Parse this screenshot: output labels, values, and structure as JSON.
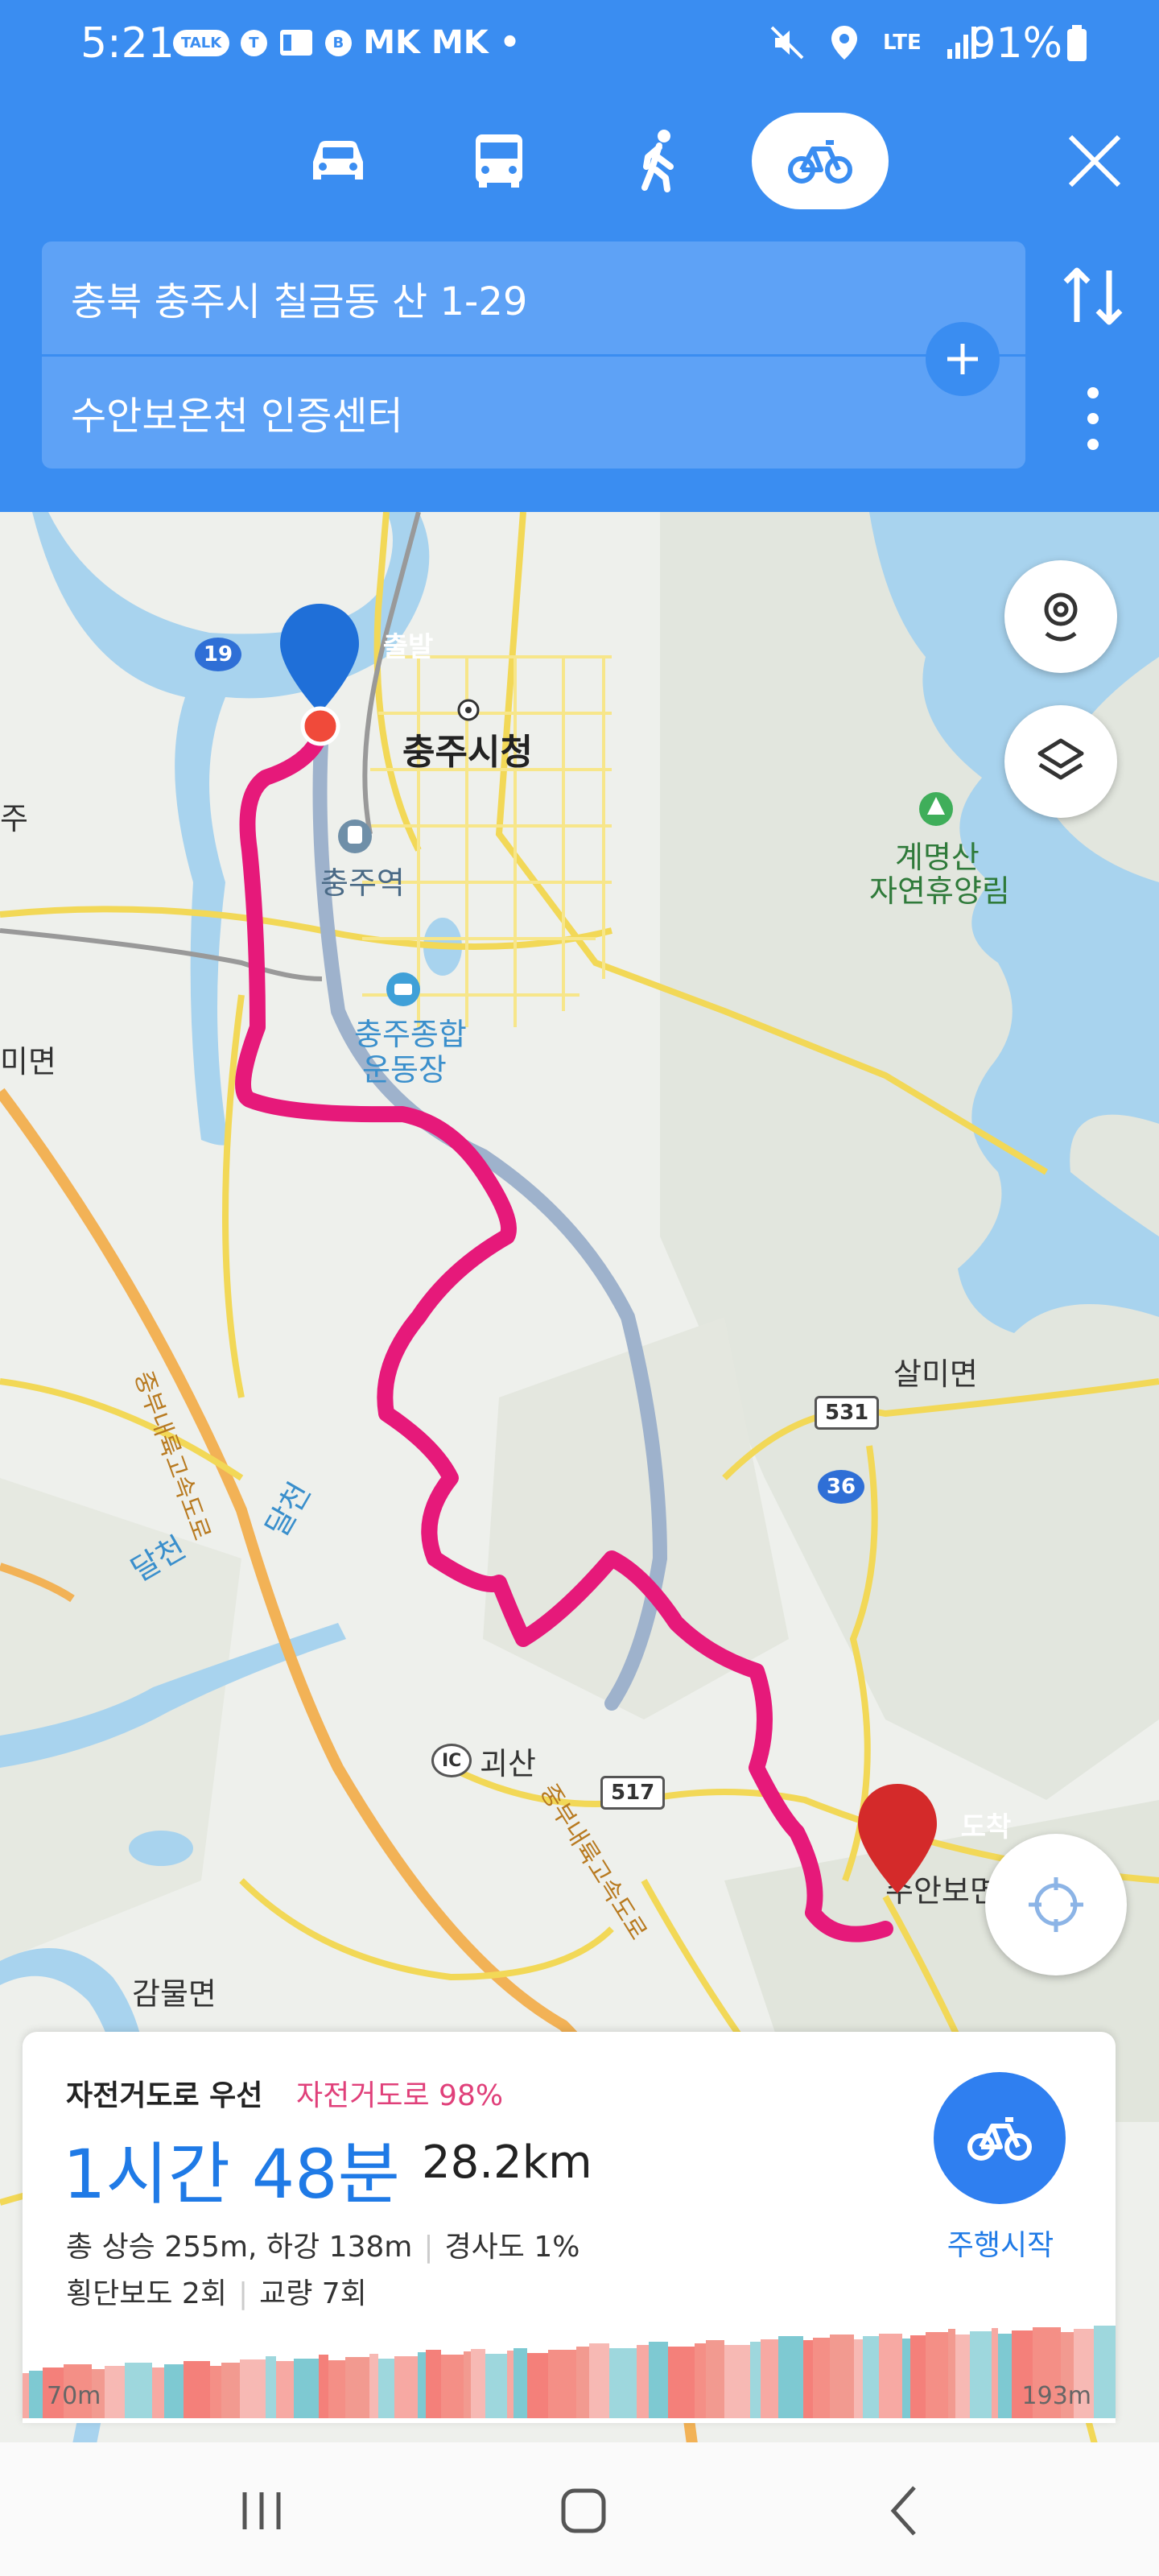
{
  "status_bar": {
    "time": "5:21",
    "app_badges": [
      "TALK",
      "T",
      "B"
    ],
    "carriers": "MK MK",
    "dot": "•",
    "lte_label": "LTE",
    "battery": "91%"
  },
  "header": {
    "modes": [
      {
        "id": "car",
        "icon": "car-icon",
        "active": false
      },
      {
        "id": "bus",
        "icon": "bus-icon",
        "active": false
      },
      {
        "id": "walk",
        "icon": "walk-icon",
        "active": false
      },
      {
        "id": "bike",
        "icon": "bike-icon",
        "active": true
      }
    ],
    "origin": "충북 충주시 칠금동 산 1-29",
    "destination": "수안보온천 인증센터"
  },
  "map": {
    "labels": {
      "city_hall": "충주시청",
      "station": "충주역",
      "stadium_line1": "충주종합",
      "stadium_line2": "운동장",
      "forest_line1": "계명산",
      "forest_line2": "자연휴양림",
      "salmi": "살미면",
      "goesan": "괴산",
      "ic": "IC",
      "gammul": "감물면",
      "suanbo": "수안보면",
      "dalcheon": "달천",
      "dalcheon2": "달천",
      "highway": "중부내륙고속도로",
      "highway2": "중부내륙고속도로",
      "left_edge": "미면",
      "left_edge2": "주"
    },
    "road_shields": [
      "19",
      "531",
      "36",
      "517"
    ],
    "start_pin": "출발",
    "end_pin": "도착"
  },
  "route_card": {
    "title": "자전거도로 우선",
    "bike_road_ratio": "자전거도로 98%",
    "duration": "1시간 48분",
    "distance": "28.2km",
    "elevation": "총 상승 255m, 하강 138m",
    "slope": "경사도 1%",
    "crosswalks": "횡단보도 2회",
    "bridges": "교량 7회",
    "start_button": "주행시작",
    "elevation_start": "70m",
    "elevation_end": "193m"
  },
  "colors": {
    "header_blue": "#3a8df1",
    "route_pink": "#e6197a",
    "accent_blue": "#1f7ae6"
  }
}
